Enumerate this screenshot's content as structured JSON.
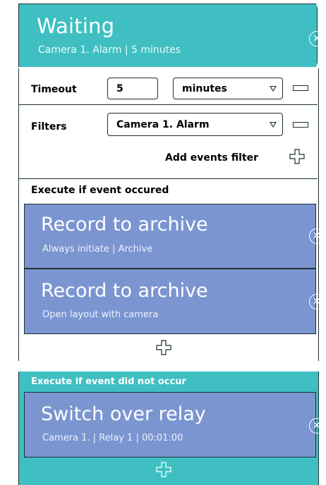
{
  "header": {
    "title": "Waiting",
    "subtitle": "Camera 1. Alarm | 5 minutes"
  },
  "timeout": {
    "label": "Timeout",
    "value": "5",
    "unit": "minutes"
  },
  "filters": {
    "label": "Filters",
    "value": "Camera 1. Alarm",
    "add_label": "Add events filter"
  },
  "occurred": {
    "header": "Execute if event occured",
    "actions": [
      {
        "title": "Record to archive",
        "subtitle": "Always initiate | Archive"
      },
      {
        "title": "Record to archive",
        "subtitle": "Open layout with camera"
      }
    ]
  },
  "not_occurred": {
    "header": "Execute if event did not occur",
    "actions": [
      {
        "title": "Switch over relay",
        "subtitle": "Camera 1. | Relay 1 | 00:01:00"
      }
    ]
  },
  "icons": {
    "close": "close-icon",
    "plus": "plus-icon",
    "minus": "minus-icon",
    "dropdown": "chevron-down-icon"
  },
  "colors": {
    "teal": "#3fbfc2",
    "card_blue": "#7b95d1",
    "border": "#1e2f31"
  }
}
